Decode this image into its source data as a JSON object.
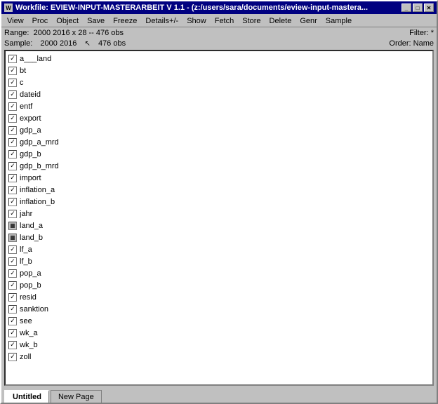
{
  "window": {
    "title": "Workfile: EVIEW-INPUT-MASTERARBEIT V 1.1 - (z:/users/sara/documents/eview-input-mastera...",
    "title_short": "Workfile: EVIEW-INPUT-MASTERARBEIT V 1.1 - (z:/users/sara/documents/eview-input-mastera..."
  },
  "titlebar": {
    "minimize": "_",
    "maximize": "□",
    "close": "✕"
  },
  "menu": {
    "items": [
      "View",
      "Proc",
      "Object",
      "Save",
      "Freeze",
      "Details+/-",
      "Show",
      "Fetch",
      "Store",
      "Delete",
      "Genr",
      "Sample"
    ]
  },
  "info": {
    "range_label": "Range:",
    "range_value": "2000 2016 x 28  --  476 obs",
    "filter_label": "Filter: *",
    "sample_label": "Sample:",
    "sample_value": "2000 2016",
    "obs_value": "476 obs",
    "order_label": "Order: Name"
  },
  "variables": [
    {
      "name": "a___land",
      "checked": true,
      "type": "check"
    },
    {
      "name": "bt",
      "checked": true,
      "type": "check"
    },
    {
      "name": "c",
      "checked": true,
      "type": "check"
    },
    {
      "name": "dateid",
      "checked": true,
      "type": "check"
    },
    {
      "name": "entf",
      "checked": true,
      "type": "check"
    },
    {
      "name": "export",
      "checked": true,
      "type": "check"
    },
    {
      "name": "gdp_a",
      "checked": true,
      "type": "check"
    },
    {
      "name": "gdp_a_mrd",
      "checked": true,
      "type": "check"
    },
    {
      "name": "gdp_b",
      "checked": true,
      "type": "check"
    },
    {
      "name": "gdp_b_mrd",
      "checked": true,
      "type": "check"
    },
    {
      "name": "import",
      "checked": true,
      "type": "check"
    },
    {
      "name": "inflation_a",
      "checked": true,
      "type": "check"
    },
    {
      "name": "inflation_b",
      "checked": true,
      "type": "check"
    },
    {
      "name": "jahr",
      "checked": true,
      "type": "check"
    },
    {
      "name": "land_a",
      "checked": false,
      "type": "icon"
    },
    {
      "name": "land_b",
      "checked": false,
      "type": "icon"
    },
    {
      "name": "lf_a",
      "checked": true,
      "type": "check"
    },
    {
      "name": "lf_b",
      "checked": true,
      "type": "check"
    },
    {
      "name": "pop_a",
      "checked": true,
      "type": "check"
    },
    {
      "name": "pop_b",
      "checked": true,
      "type": "check"
    },
    {
      "name": "resid",
      "checked": true,
      "type": "check"
    },
    {
      "name": "sanktion",
      "checked": true,
      "type": "check"
    },
    {
      "name": "see",
      "checked": true,
      "type": "check"
    },
    {
      "name": "wk_a",
      "checked": true,
      "type": "check"
    },
    {
      "name": "wk_b",
      "checked": true,
      "type": "check"
    },
    {
      "name": "zoll",
      "checked": true,
      "type": "check"
    }
  ],
  "tabs": [
    {
      "label": "Untitled",
      "active": true
    },
    {
      "label": "New Page",
      "active": false
    }
  ]
}
